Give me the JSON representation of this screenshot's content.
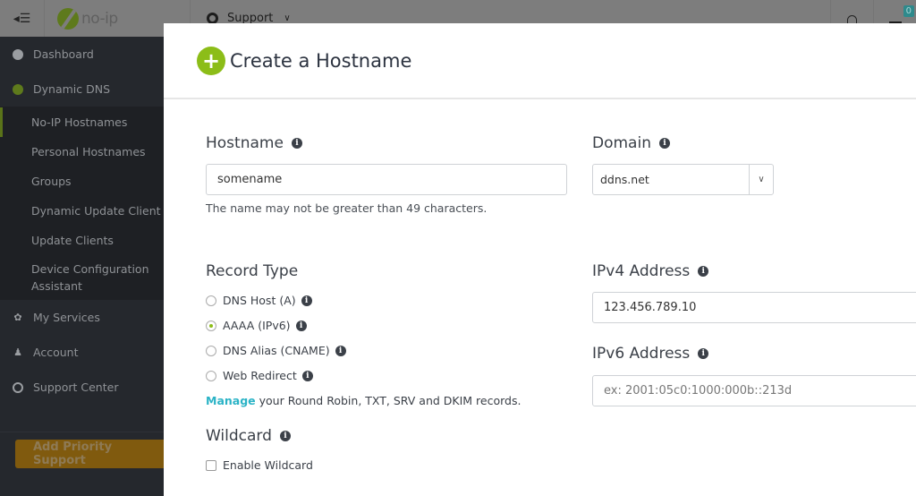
{
  "topbar": {
    "menu_toggle_icon": "sidebar-collapse-icon",
    "logo_text": "no-ip",
    "support_label": "Support",
    "cart_count": "0"
  },
  "sidebar": {
    "items": [
      {
        "label": "Dashboard",
        "icon": "dashboard-icon"
      },
      {
        "label": "Dynamic DNS",
        "icon": "globe-icon"
      }
    ],
    "sub_items": [
      {
        "label": "No-IP Hostnames",
        "active": true
      },
      {
        "label": "Personal Hostnames"
      },
      {
        "label": "Groups"
      },
      {
        "label": "Dynamic Update Client"
      },
      {
        "label": "Update Clients"
      },
      {
        "label": "Device Configuration Assistant"
      }
    ],
    "items_after": [
      {
        "label": "My Services",
        "icon": "gear-icon"
      },
      {
        "label": "Account",
        "icon": "user-icon"
      },
      {
        "label": "Support Center",
        "icon": "lifebuoy-icon"
      }
    ],
    "priority_button": "Add Priority Support"
  },
  "modal": {
    "title": "Create a Hostname",
    "hostname": {
      "label": "Hostname",
      "value": "somename",
      "help": "The name may not be greater than 49 characters."
    },
    "domain": {
      "label": "Domain",
      "selected": "ddns.net"
    },
    "record_type": {
      "label": "Record Type",
      "options": [
        {
          "label": "DNS Host (A)",
          "checked": false
        },
        {
          "label": "AAAA (IPv6)",
          "checked": true
        },
        {
          "label": "DNS Alias (CNAME)",
          "checked": false
        },
        {
          "label": "Web Redirect",
          "checked": false
        }
      ]
    },
    "manage": {
      "link": "Manage",
      "text": " your Round Robin, TXT, SRV and DKIM records."
    },
    "ipv4": {
      "label": "IPv4 Address",
      "value": "123.456.789.10"
    },
    "ipv6": {
      "label": "IPv6 Address",
      "placeholder": "ex: 2001:05c0:1000:000b::213d"
    },
    "wildcard": {
      "label": "Wildcard",
      "checkbox_label": "Enable Wildcard",
      "checked": false
    }
  },
  "colors": {
    "accent_green": "#8cbd18",
    "link_teal": "#2bb3c6",
    "priority_orange": "#805a0e",
    "sidebar_bg": "#25282d"
  }
}
